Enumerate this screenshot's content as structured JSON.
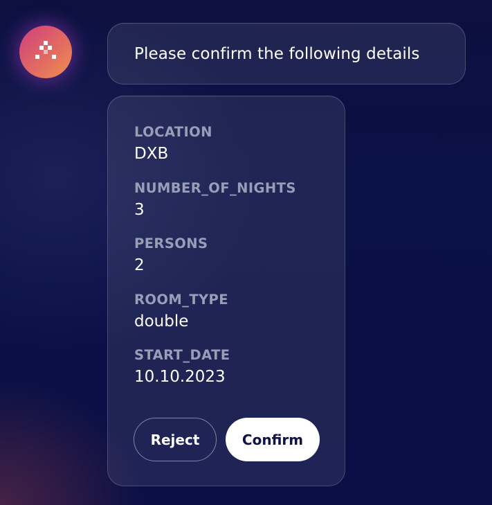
{
  "assistant": {
    "avatar_icon": "dots-triangle-logo-icon",
    "colors": {
      "gradient_start": "#cf3f7d",
      "gradient_end": "#f08e4f"
    }
  },
  "message": {
    "text": "Please confirm the following details"
  },
  "details": {
    "fields": [
      {
        "label": "LOCATION",
        "value": "DXB"
      },
      {
        "label": "NUMBER_OF_NIGHTS",
        "value": "3"
      },
      {
        "label": "PERSONS",
        "value": "2"
      },
      {
        "label": "ROOM_TYPE",
        "value": "double"
      },
      {
        "label": "START_DATE",
        "value": "10.10.2023"
      }
    ]
  },
  "actions": {
    "reject_label": "Reject",
    "confirm_label": "Confirm"
  }
}
